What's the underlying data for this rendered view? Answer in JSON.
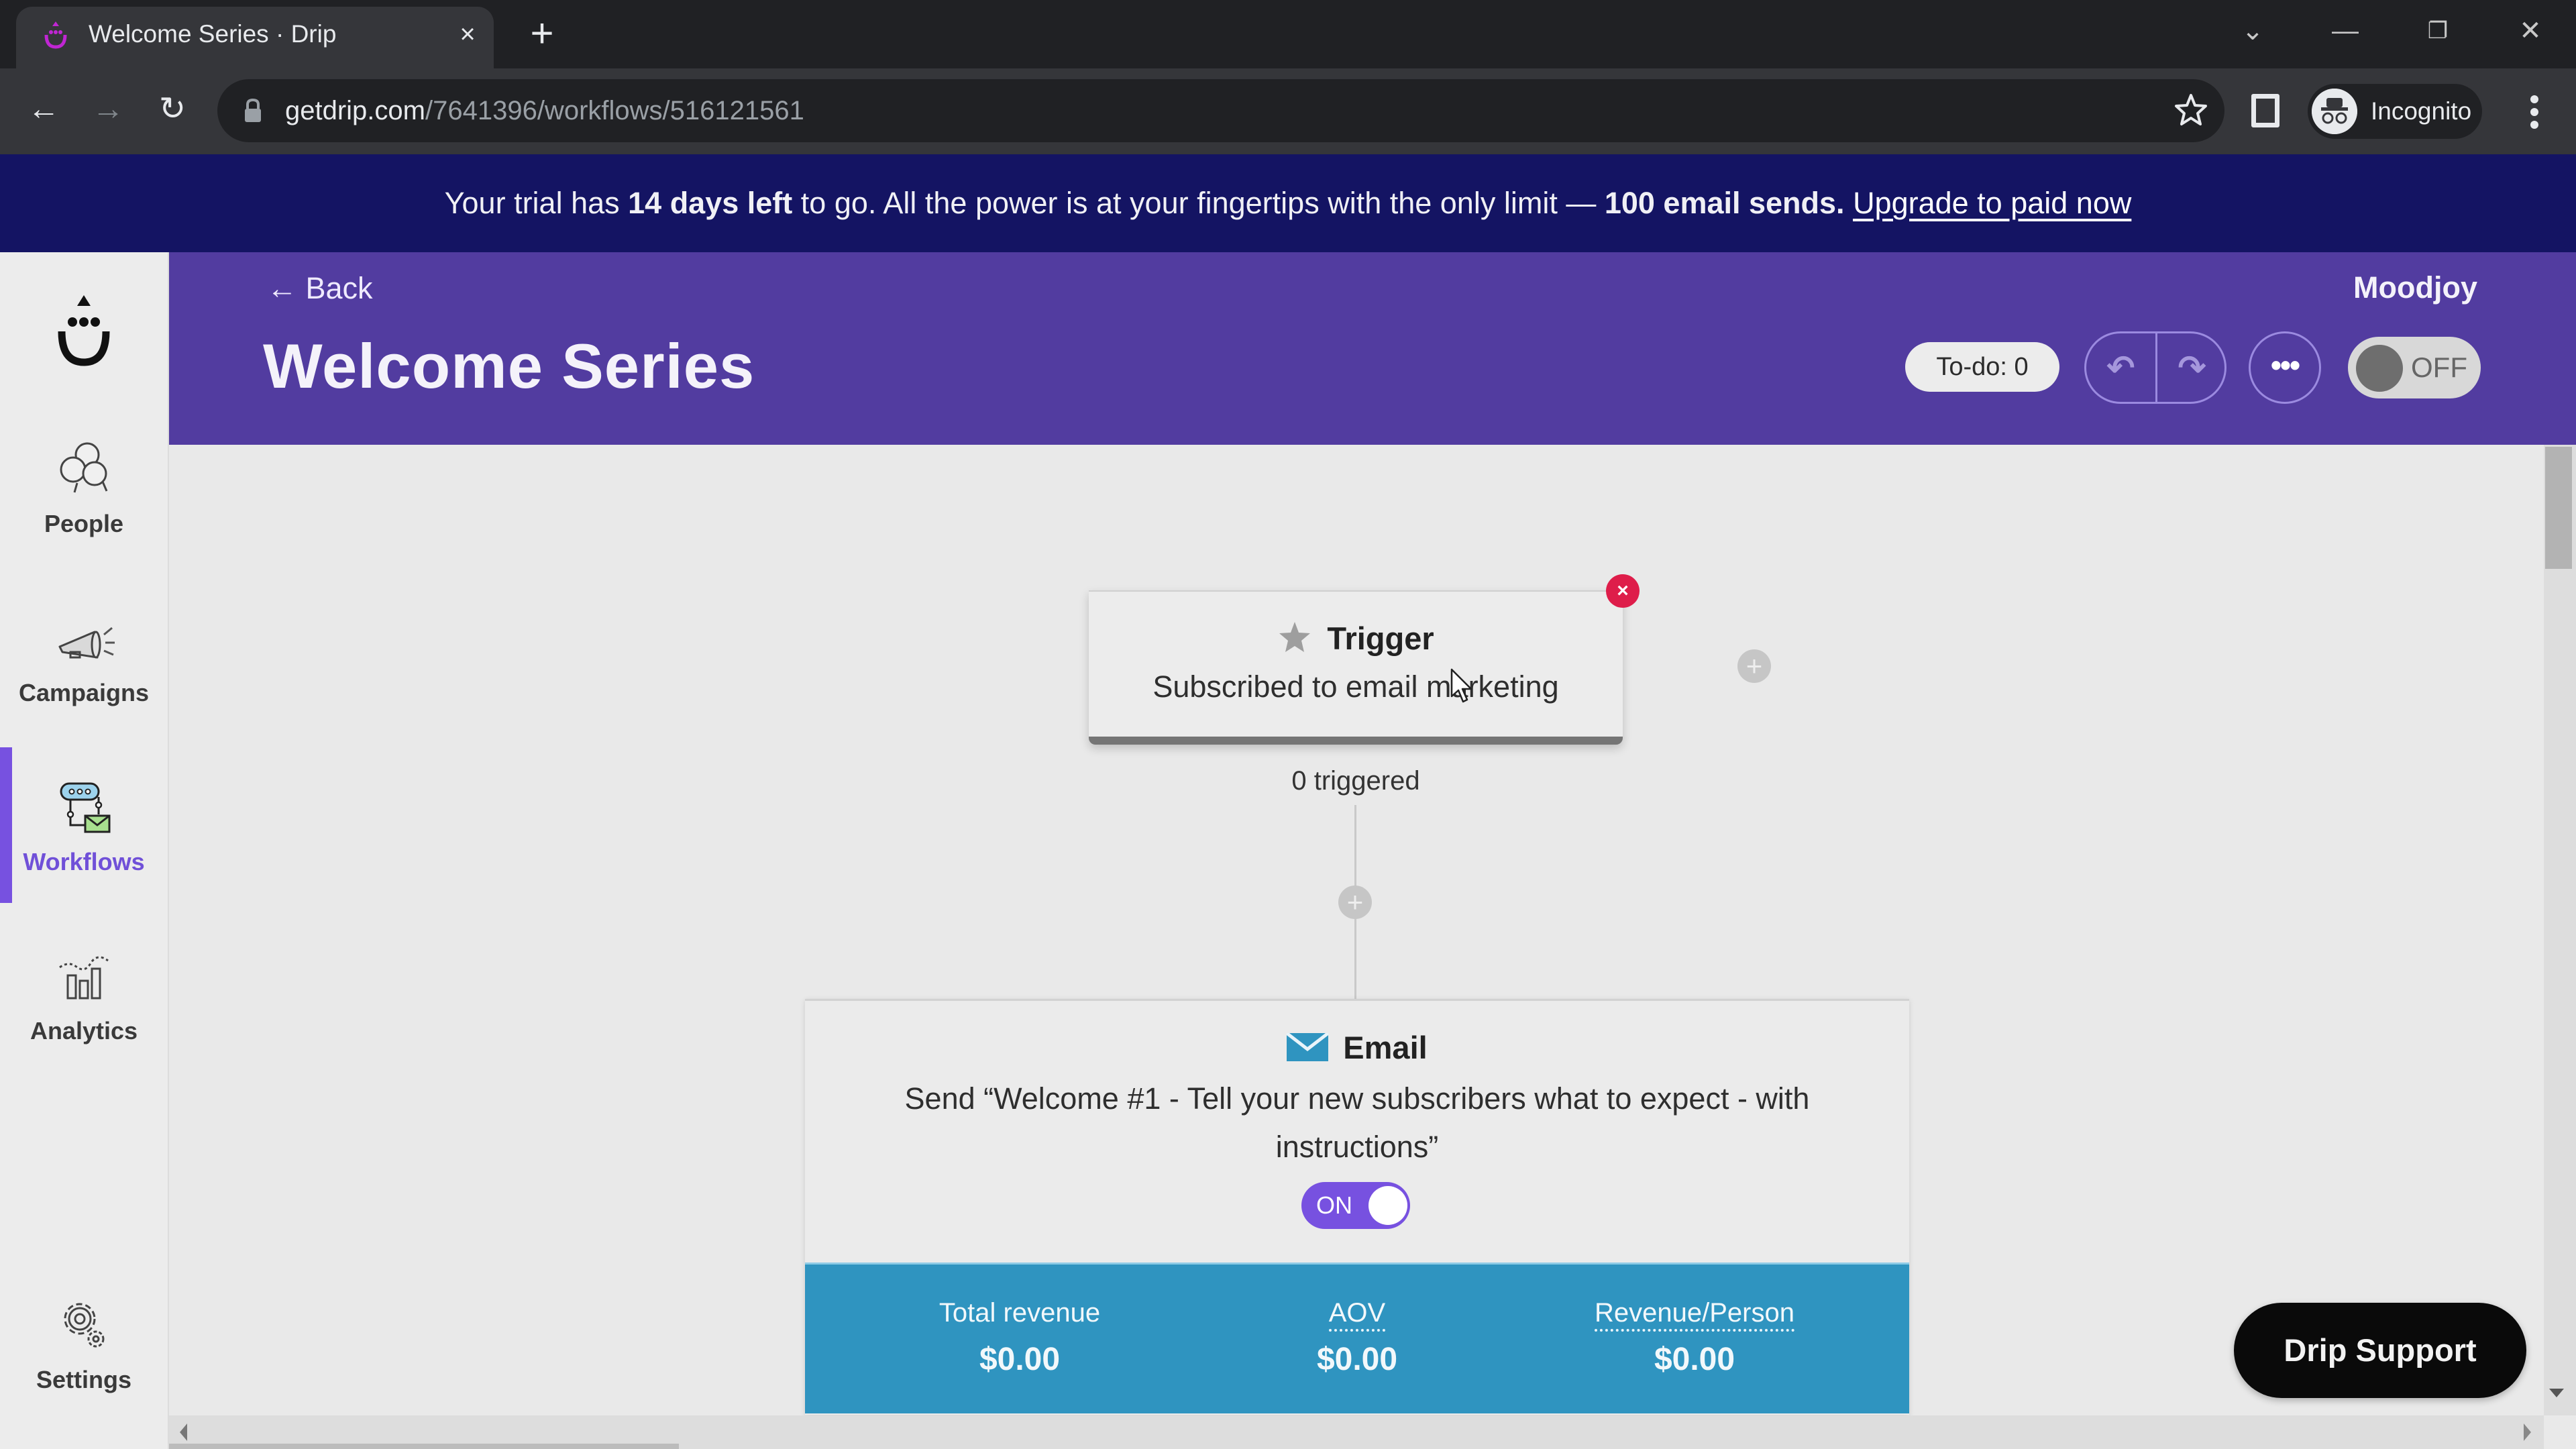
{
  "browser": {
    "tab_title": "Welcome Series · Drip",
    "tab_close": "×",
    "new_tab": "+",
    "url_host": "getdrip.com",
    "url_path": "/7641396/workflows/516121561",
    "profile_label": "Incognito",
    "window_controls": {
      "tab_search": "⌄",
      "minimize": "—",
      "restore": "❐",
      "close": "✕"
    },
    "nav": {
      "back": "←",
      "forward": "→",
      "reload": "↻"
    }
  },
  "banner": {
    "text_1": "Your trial has ",
    "bold_1": "14 days left",
    "text_2": " to go. All the power is at your fingertips with the only limit — ",
    "bold_2": "100 email sends.",
    "text_3": " ",
    "link": "Upgrade to paid now"
  },
  "sidebar": {
    "items": [
      {
        "label": "People",
        "icon": "people-icon",
        "active": false
      },
      {
        "label": "Campaigns",
        "icon": "megaphone-icon",
        "active": false
      },
      {
        "label": "Workflows",
        "icon": "workflow-icon",
        "active": true
      },
      {
        "label": "Analytics",
        "icon": "analytics-icon",
        "active": false
      },
      {
        "label": "Settings",
        "icon": "gear-icon",
        "active": false
      }
    ]
  },
  "header": {
    "back_label": "← Back",
    "title": "Welcome Series",
    "account": "Moodjoy",
    "todo": "To-do: 0",
    "undo": "↶",
    "redo": "↷",
    "more": "•••",
    "workflow_toggle": {
      "label": "OFF",
      "state": "off"
    }
  },
  "workflow": {
    "trigger": {
      "heading": "Trigger",
      "description": "Subscribed to email marketing",
      "remove": "×",
      "count": "0 triggered"
    },
    "add_step": "+",
    "email_step": {
      "heading": "Email",
      "description": "Send “Welcome #1 - Tell your new subscribers what to expect - with instructions”",
      "toggle": {
        "label": "ON",
        "state": "on"
      },
      "stats": [
        {
          "label": "Total revenue",
          "value": "$0.00",
          "tooltip": false
        },
        {
          "label": "AOV",
          "value": "$0.00",
          "tooltip": true
        },
        {
          "label": "Revenue/Person",
          "value": "$0.00",
          "tooltip": true
        }
      ]
    }
  },
  "support_button": "Drip Support",
  "colors": {
    "header_purple": "#523ca0",
    "banner_navy": "#141463",
    "accent_purple": "#7751e0",
    "stats_blue": "#2f94c0",
    "remove_red": "#de1d4a"
  }
}
